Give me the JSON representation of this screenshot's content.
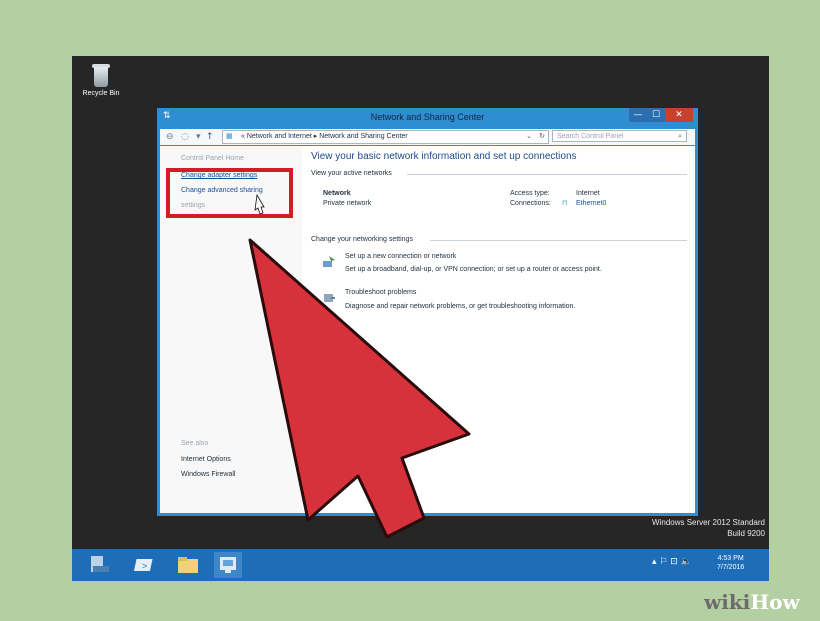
{
  "desktop": {
    "recycle_bin_label": "Recycle Bin",
    "watermark_line1": "Windows Server 2012 Standard",
    "watermark_line2": "Build 9200"
  },
  "window": {
    "title": "Network and Sharing Center",
    "buttons": {
      "minimize": "—",
      "maximize": "☐",
      "close": "✕"
    },
    "address": {
      "crumbs": "«  Network and Internet  ▸  Network and Sharing Center",
      "dropdown": "⌄",
      "refresh": "↻"
    },
    "search_placeholder": "Search Control Panel",
    "search_icon": "⌕"
  },
  "left_pane": {
    "home": "Control Panel Home",
    "links": [
      "Change adapter settings",
      "Change advanced sharing",
      "settings"
    ],
    "see_also": "See also",
    "see_also_links": [
      "Internet Options",
      "Windows Firewall"
    ]
  },
  "main": {
    "heading": "View your basic network information and set up connections",
    "active_networks_label": "View your active networks",
    "network_name": "Network",
    "network_type": "Private network",
    "access_type_label": "Access type:",
    "access_type_value": "Internet",
    "connections_label": "Connections:",
    "connections_value": "Ethernet0",
    "change_settings_label": "Change your networking settings",
    "tasks": [
      {
        "title": "Set up a new connection or network",
        "desc": "Set up a broadband, dial-up, or VPN connection; or set up a router or access point."
      },
      {
        "title": "Troubleshoot problems",
        "desc": "Diagnose and repair network problems, or get troubleshooting information."
      }
    ]
  },
  "taskbar": {
    "clock_time": "4:53 PM",
    "clock_date": "7/7/2016",
    "tray_glyphs": "▴  ⚐  ⊡  🔈"
  },
  "branding": {
    "wiki": "wiki",
    "how": "How"
  },
  "colors": {
    "highlight": "#d31d24",
    "arrow": "#d7323b",
    "titlebar": "#2e8ed1",
    "taskbar": "#1d6db8"
  }
}
